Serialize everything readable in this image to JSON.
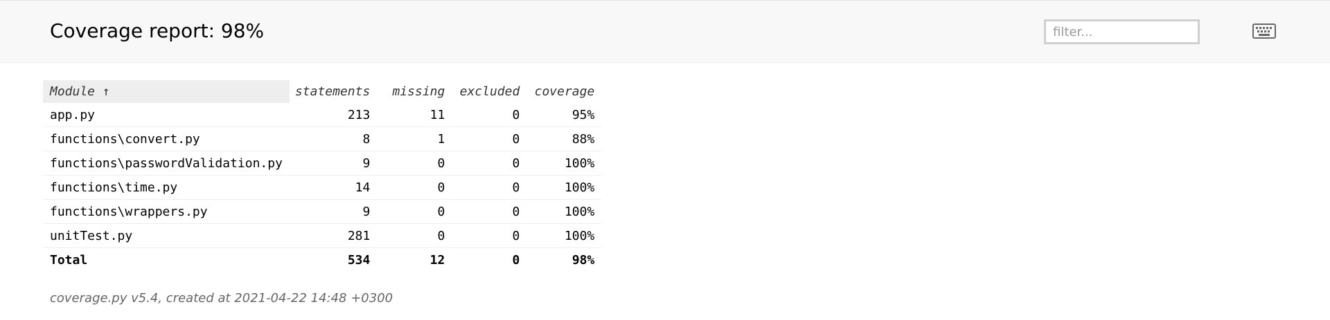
{
  "header": {
    "title": "Coverage report: 98%",
    "filter_placeholder": "filter...",
    "keyboard_icon": "keyboard-icon"
  },
  "table": {
    "columns": [
      "Module ↑",
      "statements",
      "missing",
      "excluded",
      "coverage"
    ],
    "rows": [
      {
        "module": "app.py",
        "statements": "213",
        "missing": "11",
        "excluded": "0",
        "coverage": "95%"
      },
      {
        "module": "functions\\convert.py",
        "statements": "8",
        "missing": "1",
        "excluded": "0",
        "coverage": "88%"
      },
      {
        "module": "functions\\passwordValidation.py",
        "statements": "9",
        "missing": "0",
        "excluded": "0",
        "coverage": "100%"
      },
      {
        "module": "functions\\time.py",
        "statements": "14",
        "missing": "0",
        "excluded": "0",
        "coverage": "100%"
      },
      {
        "module": "functions\\wrappers.py",
        "statements": "9",
        "missing": "0",
        "excluded": "0",
        "coverage": "100%"
      },
      {
        "module": "unitTest.py",
        "statements": "281",
        "missing": "0",
        "excluded": "0",
        "coverage": "100%"
      }
    ],
    "total": {
      "module": "Total",
      "statements": "534",
      "missing": "12",
      "excluded": "0",
      "coverage": "98%"
    }
  },
  "footer": {
    "text": "coverage.py v5.4, created at 2021-04-22 14:48 +0300"
  }
}
